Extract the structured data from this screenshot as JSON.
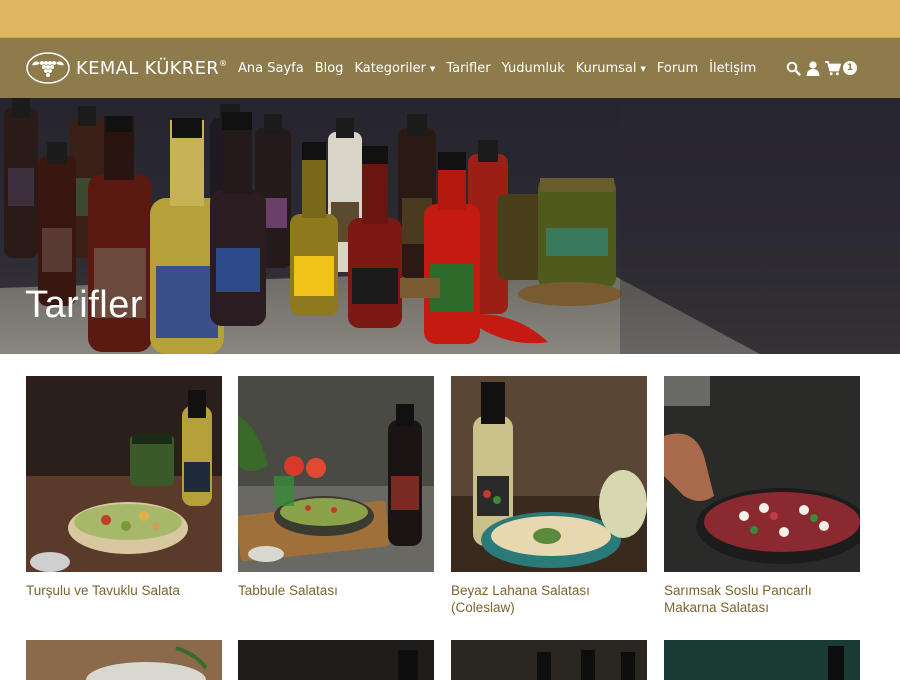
{
  "brand": {
    "name": "KEMAL KÜKRER",
    "mark": "®"
  },
  "nav": {
    "items": [
      {
        "label": "Ana Sayfa",
        "dropdown": false
      },
      {
        "label": "Blog",
        "dropdown": false
      },
      {
        "label": "Kategoriler",
        "dropdown": true
      },
      {
        "label": "Tarifler",
        "dropdown": false
      },
      {
        "label": "Yudumluk",
        "dropdown": false
      },
      {
        "label": "Kurumsal",
        "dropdown": true
      },
      {
        "label": "Forum",
        "dropdown": false
      },
      {
        "label": "İletişim",
        "dropdown": false
      }
    ],
    "icons": [
      "search-icon",
      "user-icon",
      "cart-icon"
    ],
    "cart_count": "1"
  },
  "hero": {
    "title": "Tarifler"
  },
  "recipes": [
    {
      "title": "Turşulu ve Tavuklu Salata"
    },
    {
      "title": "Tabbule Salatası"
    },
    {
      "title": "Beyaz Lahana Salatası (Coleslaw)"
    },
    {
      "title": "Sarımsak Soslu Pancarlı Makarna Salatası"
    }
  ],
  "colors": {
    "topbar": "#e0b660",
    "navbar": "#8d7b4c",
    "recipe_title": "#7a6430"
  }
}
